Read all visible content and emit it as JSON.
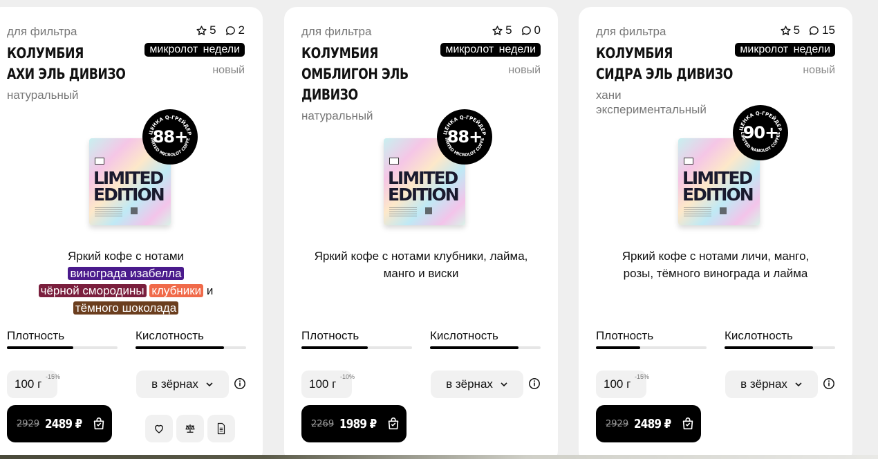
{
  "colors": {
    "accent_black": "#000000",
    "badge_bg": "#000000",
    "note_grape_isabella": "#4a1a8c",
    "note_blackcurrant": "#7a1f3d",
    "note_strawberry": "#f06a4a",
    "note_dark_chocolate": "#6b3e1e"
  },
  "cards": [
    {
      "category": "для фильтра",
      "rating": "5",
      "reviews": "2",
      "title_line1": "Колумбия",
      "title_line2": "Ахи Эль Дивизо",
      "badge": "микролот недели",
      "new_label": "новый",
      "process_line1": "натуральный",
      "seal_score": "88+",
      "seal_top_text": "ОЦЕНКА Q-ГРЕЙДЕРА",
      "seal_bottom_text": "LIMITED MICROLOT COFFEE",
      "pack_text_1": "LIMITED",
      "pack_text_2": "EDITION",
      "desc_lead": "Яркий кофе с нотами",
      "notes": [
        "винограда изабелла",
        "чёрной смородины",
        "клубники",
        "тёмного шоколада"
      ],
      "desc_and": "и",
      "density_label": "Плотность",
      "density_level": 0.6,
      "acidity_label": "Кислотность",
      "acidity_level": 0.8,
      "weight": "100 г",
      "discount": "-15%",
      "grind": "в зёрнах",
      "old_price": "2929",
      "price": "2489 ₽"
    },
    {
      "category": "для фильтра",
      "rating": "5",
      "reviews": "0",
      "title_line1": "Колумбия",
      "title_line2": "Омблигон Эль",
      "title_line3": "Дивизо",
      "badge": "микролот недели",
      "new_label": "новый",
      "process_line1": "натуральный",
      "seal_score": "88+",
      "seal_top_text": "ОЦЕНКА Q-ГРЕЙДЕРА",
      "seal_bottom_text": "LIMITED MICROLOT COFFEE",
      "pack_text_1": "LIMITED",
      "pack_text_2": "EDITION",
      "desc": "Яркий кофе с нотами клубники, лайма, манго и виски",
      "density_label": "Плотность",
      "density_level": 0.6,
      "acidity_label": "Кислотность",
      "acidity_level": 0.8,
      "weight": "100 г",
      "discount": "-10%",
      "grind": "в зёрнах",
      "old_price": "2269",
      "price": "1989 ₽"
    },
    {
      "category": "для фильтра",
      "rating": "5",
      "reviews": "15",
      "title_line1": "Колумбия",
      "title_line2": "Сидра Эль Дивизо",
      "badge": "микролот недели",
      "new_label": "новый",
      "process_line1": "хани",
      "process_line2": "экспериментальный",
      "seal_score": "90+",
      "seal_top_text": "ОЦЕНКА Q-ГРЕЙДЕРА",
      "seal_bottom_text": "LIMITED NANOLOT COFFEE",
      "pack_text_1": "LIMITED",
      "pack_text_2": "EDITION",
      "desc": "Яркий кофе с нотами личи, манго, розы, тёмного винограда и лайма",
      "density_label": "Плотность",
      "density_level": 0.4,
      "acidity_label": "Кислотность",
      "acidity_level": 0.8,
      "weight": "100 г",
      "discount": "-15%",
      "grind": "в зёрнах",
      "old_price": "2929",
      "price": "2489 ₽"
    }
  ],
  "icons": {
    "rating": "star-icon",
    "reviews": "comment-icon",
    "grind_toggle": "chevron-down-icon",
    "info": "info-icon",
    "cart": "shopping-bag-icon",
    "favorite": "heart-icon",
    "compare": "scales-icon",
    "details": "document-icon"
  }
}
